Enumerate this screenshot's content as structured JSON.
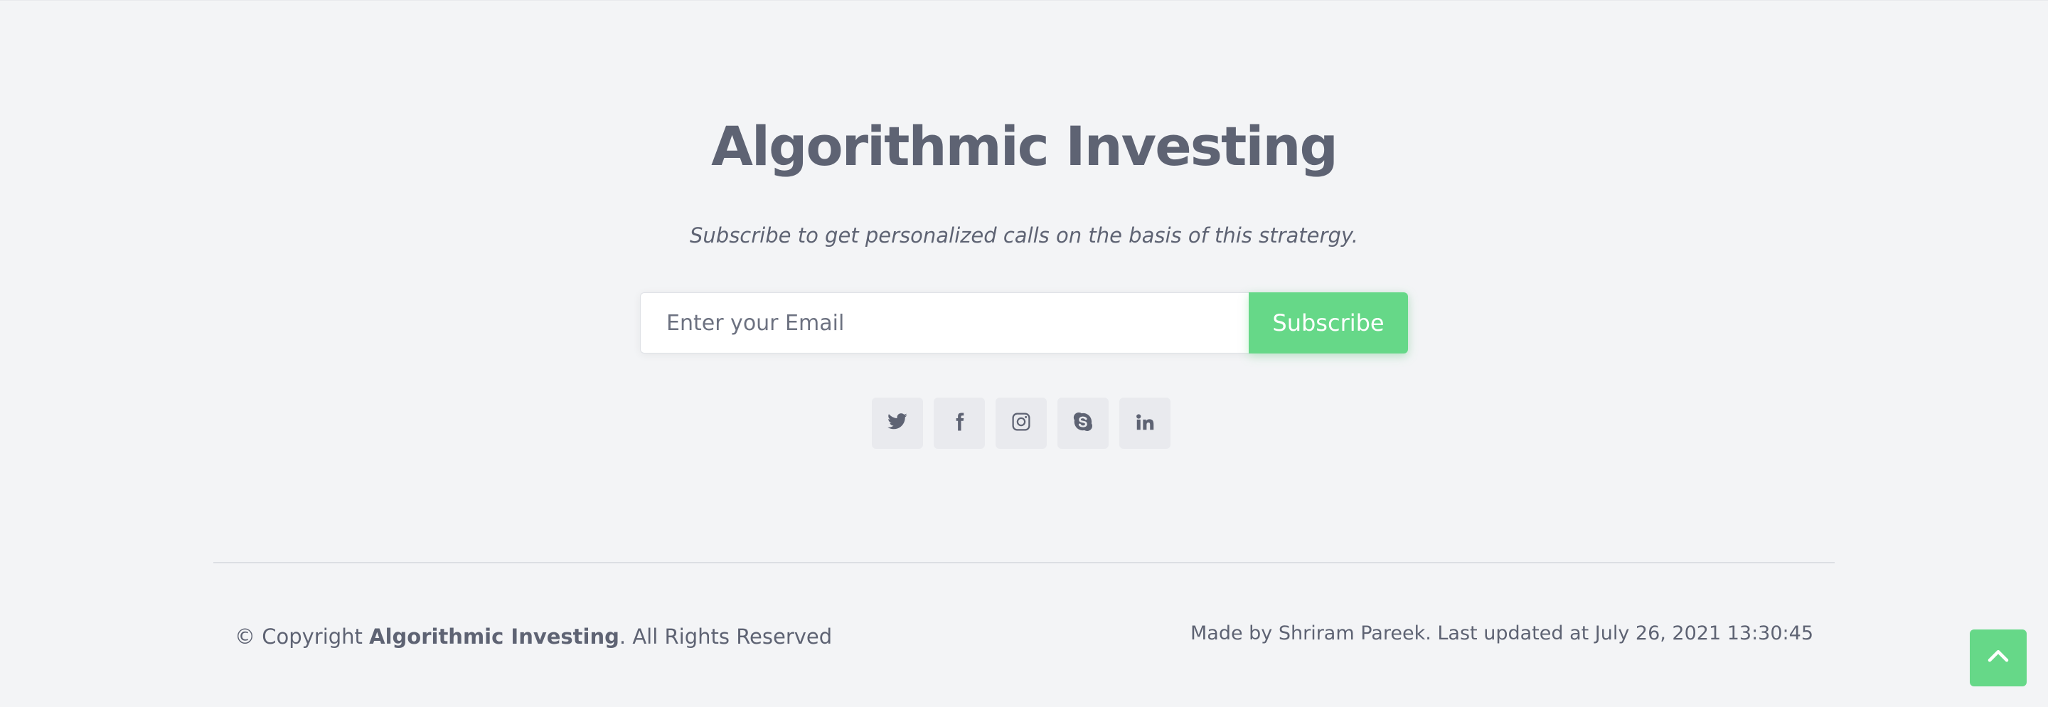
{
  "footer": {
    "title": "Algorithmic Investing",
    "tagline": "Subscribe to get personalized calls on the basis of this stratergy.",
    "subscribe": {
      "placeholder": "Enter your Email",
      "button_label": "Subscribe"
    },
    "social": [
      {
        "name": "twitter",
        "icon": "twitter-icon"
      },
      {
        "name": "facebook",
        "icon": "facebook-icon"
      },
      {
        "name": "instagram",
        "icon": "instagram-icon"
      },
      {
        "name": "skype",
        "icon": "skype-icon"
      },
      {
        "name": "linkedin",
        "icon": "linkedin-icon"
      }
    ],
    "copyright": {
      "prefix": "© Copyright ",
      "brand": "Algorithmic Investing",
      "suffix": ". All Rights Reserved"
    },
    "credits": "Made by Shriram Pareek. Last updated at July 26, 2021 13:30:45",
    "back_to_top_icon": "chevron-up-icon"
  },
  "colors": {
    "background": "#f3f4f6",
    "text": "#5e6373",
    "accent": "#66d888",
    "social_bg": "#e9eaee"
  }
}
